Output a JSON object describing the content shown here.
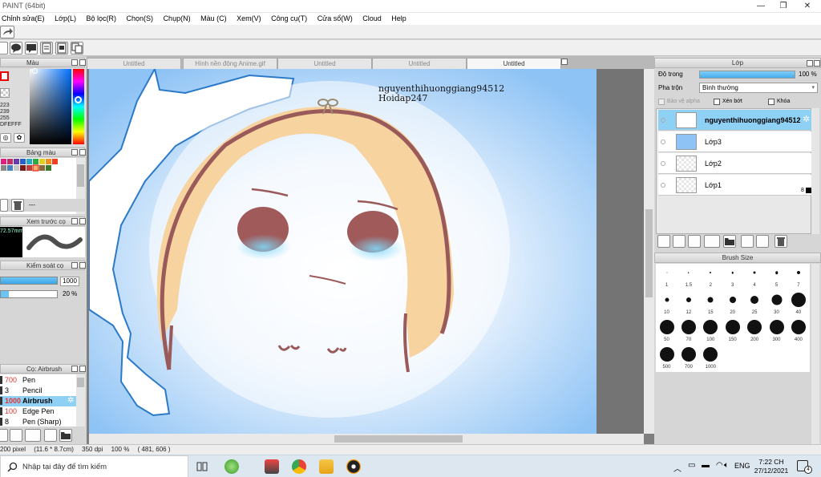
{
  "window": {
    "title": "PAINT (64bit)"
  },
  "menu": [
    "Chỉnh sửa(E)",
    "Lớp(L)",
    "Bộ lọc(R)",
    "Chọn(S)",
    "Chụp(N)",
    "Màu (C)",
    "Xem(V)",
    "Công cụ(T)",
    "Cửa sổ(W)",
    "Cloud",
    "Help"
  ],
  "left": {
    "color_panel_title": "Màu",
    "color_values": [
      "223",
      "239",
      "255",
      "DFEFFF"
    ],
    "swatch_panel_title": "Bảng màu",
    "swatch_dash": "---",
    "preview_panel_title": "Xem trước cọ",
    "preview_size": "72.57mm",
    "control_panel_title": "Kiểm soát cọ",
    "size_value": "1000",
    "opacity_value": "20 %",
    "brush_panel_title": "Cọ: Airbrush",
    "brushes": [
      {
        "size": "700",
        "name": "Pen"
      },
      {
        "size": "3",
        "name": "Pencil"
      },
      {
        "size": "1000",
        "name": "Airbrush"
      },
      {
        "size": "100",
        "name": "Edge Pen"
      },
      {
        "size": "8",
        "name": "Pen (Sharp)"
      }
    ]
  },
  "tabs": [
    "Untitled",
    "Hình nền động Anime.gif",
    "Untitled",
    "Untitled",
    "Untitled"
  ],
  "canvas": {
    "watermark_line1": "nguyenthihuonggiang94512",
    "watermark_line2": "Hoidap247"
  },
  "layer_panel": {
    "title": "Lớp",
    "opacity_label": "Độ trong",
    "opacity_value": "100 %",
    "opacity_level": 1.0,
    "blend_label": "Pha trộn",
    "blend_value": "Bình thường",
    "protect_alpha": "Bảo vệ alpha",
    "clipping": "Xén bớt",
    "lock": "Khóa",
    "layers": [
      {
        "name": "nguyenthihuonggiang94512",
        "selected": true
      },
      {
        "name": "Lớp3",
        "selected": false
      },
      {
        "name": "Lớp2",
        "selected": false
      },
      {
        "name": "Lớp1",
        "selected": false
      }
    ],
    "layer1_badge": "8"
  },
  "brush_size": {
    "title": "Brush Size",
    "sizes": [
      "1",
      "1.5",
      "2",
      "3",
      "4",
      "5",
      "7",
      "10",
      "12",
      "15",
      "20",
      "25",
      "30",
      "40",
      "50",
      "70",
      "100",
      "150",
      "200",
      "300",
      "400",
      "500",
      "700",
      "1000"
    ]
  },
  "status": {
    "pixels": "200 pixel",
    "cm": "(11.6 * 8.7cm)",
    "dpi": "350 dpi",
    "zoom": "100 %",
    "coords": "( 481, 606 )"
  },
  "taskbar": {
    "search_placeholder": "Nhập tại đây để tìm kiếm",
    "lang": "ENG",
    "time": "7:22 CH",
    "date": "27/12/2021",
    "notif_count": "4"
  },
  "colors": {
    "accent": "#8fd0f5",
    "outline": "#9a5a5a",
    "hair": "#f7d3a0"
  }
}
